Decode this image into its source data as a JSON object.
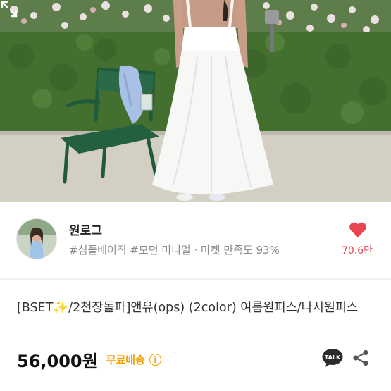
{
  "shop": {
    "name": "원로그",
    "tags": "#심플베이직 #모던 미니멀 · 마켓 만족도 93%",
    "likes": "70.6만"
  },
  "product": {
    "title": "[BSET✨/2천장돌파]앤유(ops) (2color) 여름원피스/나시원피스",
    "price": "56,000원",
    "shipping": "무료배송",
    "info_glyph": "i",
    "talk_label": "TALK"
  },
  "colors": {
    "like_red": "#e8454f",
    "shipping_orange": "#f4a000",
    "kakao_black": "#2a2a2a"
  },
  "icons": [
    "expand-icon",
    "heart-icon",
    "info-icon",
    "kakaotalk-icon",
    "share-icon"
  ]
}
